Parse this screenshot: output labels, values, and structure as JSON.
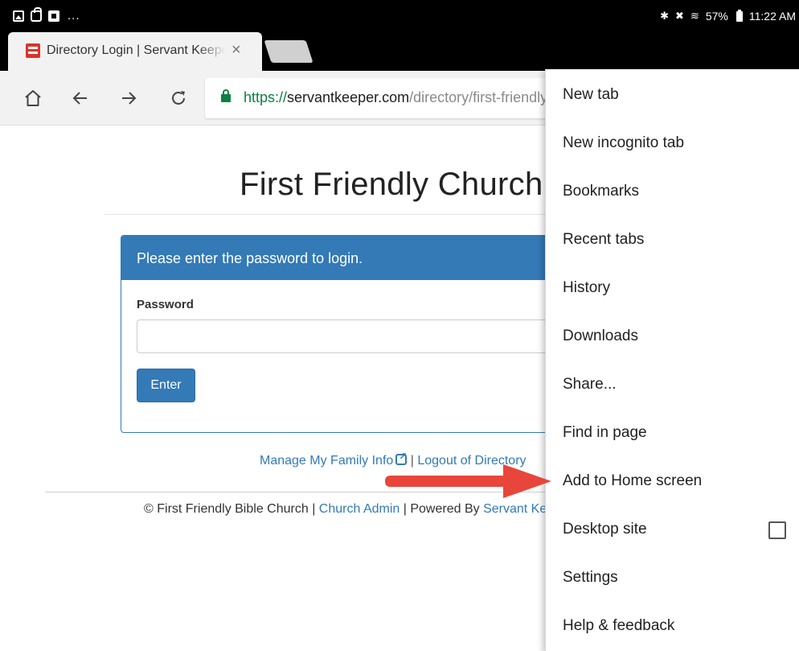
{
  "status_bar": {
    "battery": "57%",
    "time": "11:22 AM",
    "notification_icons": [
      "image-icon",
      "shopping-bag-icon",
      "a-icon",
      "more-dots"
    ],
    "system_icons": [
      "bluetooth-icon",
      "mute-icon",
      "wifi-icon",
      "battery-icon"
    ]
  },
  "tab": {
    "title": "Directory Login | Servant Keeper",
    "close_glyph": "×",
    "favicon_color": "#d9352b"
  },
  "toolbar": {
    "url_scheme": "https://",
    "url_host": "servantkeeper.com",
    "url_path": "/directory/first-friendly",
    "icons": [
      "home-icon",
      "back-icon",
      "forward-icon",
      "reload-icon",
      "lock-icon"
    ]
  },
  "page": {
    "title": "First Friendly Church",
    "panel_heading": "Please enter the password to login.",
    "password_label": "Password",
    "password_value": "",
    "enter_button": "Enter",
    "links": {
      "manage": "Manage My Family Info",
      "separator": "|",
      "logout": "Logout of Directory"
    },
    "footer": {
      "copyright": "© First Friendly Bible Church",
      "sep": "|",
      "admin_link": "Church Admin",
      "powered_by": "Powered By",
      "powered_link": "Servant Keeper"
    },
    "accent_color": "#337ab7"
  },
  "menu": {
    "items": [
      {
        "label": "New tab"
      },
      {
        "label": "New incognito tab"
      },
      {
        "label": "Bookmarks"
      },
      {
        "label": "Recent tabs"
      },
      {
        "label": "History"
      },
      {
        "label": "Downloads"
      },
      {
        "label": "Share..."
      },
      {
        "label": "Find in page"
      },
      {
        "label": "Add to Home screen"
      },
      {
        "label": "Desktop site",
        "checkbox": false
      },
      {
        "label": "Settings"
      },
      {
        "label": "Help & feedback"
      }
    ]
  },
  "annotation": {
    "arrow_color": "#e8463a",
    "points_to": "Add to Home screen"
  }
}
